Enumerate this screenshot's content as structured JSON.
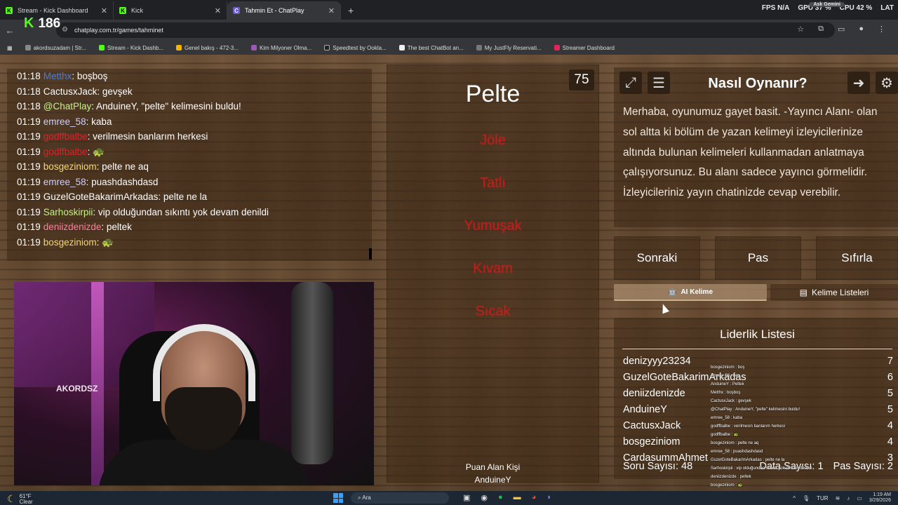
{
  "browser": {
    "tabs": [
      {
        "label": "Stream - Kick Dashboard",
        "icon": "kick-icon"
      },
      {
        "label": "Kick",
        "icon": "kick-icon"
      },
      {
        "label": "Tahmin Et - ChatPlay",
        "icon": "chatplay-icon",
        "active": true
      }
    ],
    "new_tab": "+",
    "url": "chatplay.com.tr/games/tahminet",
    "stats": {
      "fps": "FPS N/A",
      "gpu": "GPU 37 %",
      "cpu": "CPU 42 %",
      "lat": "LAT",
      "pill": "Ask Gemini"
    },
    "bookmarks": [
      "akordsuzadam | Str...",
      "Stream - Kick Dashb...",
      "Genel bakış - 472-3...",
      "Kim Milyoner Olma...",
      "Speedtest by Ookla...",
      "The best ChatBot an...",
      "My JustFly Reservati...",
      "Streamer Dashboard"
    ],
    "viewers": "186"
  },
  "chat": [
    {
      "time": "01:18",
      "user": "Metthx",
      "color": "#4a7bd8",
      "msg": ": boşboş"
    },
    {
      "time": "01:18",
      "user": "CactusxJack",
      "color": "#ffffff",
      "msg": ": gevşek"
    },
    {
      "time": "01:18",
      "user": "@ChatPlay",
      "color": "#c4f08a",
      "msg": ": AnduineY, \"pelte\" kelimesini buldu!"
    },
    {
      "time": "01:19",
      "user": "emree_58",
      "color": "#d0d0ff",
      "msg": ": kaba"
    },
    {
      "time": "01:19",
      "user": "godffbalbe",
      "color": "#e0202a",
      "msg": ": verilmesin banlarım herkesi"
    },
    {
      "time": "01:19",
      "user": "godffbalbe",
      "color": "#e0202a",
      "msg": ": 🐢"
    },
    {
      "time": "01:19",
      "user": "bosgeziniom",
      "color": "#f5d76e",
      "msg": ": pelte ne aq"
    },
    {
      "time": "01:19",
      "user": "emree_58",
      "color": "#d0d0ff",
      "msg": ": puashdashdasd"
    },
    {
      "time": "01:19",
      "user": "GuzelGoteBakarimArkadas",
      "color": "#ffffff",
      "msg": ": pelte ne la"
    },
    {
      "time": "01:19",
      "user": "Sarhoskirpii",
      "color": "#c4f08a",
      "msg": ": vip olduğundan sıkıntı yok devam denildi"
    },
    {
      "time": "01:19",
      "user": "deniizdenizde",
      "color": "#ff7b9c",
      "msg": ": peltek"
    },
    {
      "time": "01:19",
      "user": "bosgeziniom",
      "color": "#f5d76e",
      "msg": ": 🐢"
    }
  ],
  "webcam": {
    "logo": "AKORDSZ"
  },
  "game": {
    "timer": "75",
    "word": "Pelte",
    "taboo": [
      "Jöle",
      "Tatlı",
      "Yumuşak",
      "Kıvam",
      "Sıcak"
    ],
    "scorer_label": "Puan Alan Kişi",
    "scorer_name": "AnduineY"
  },
  "howto": {
    "title": "Nasıl Oynanır?",
    "text": "Merhaba, oyunumuz gayet basit. -Yayıncı Alanı- olan sol altta ki bölüm de yazan kelimeyi izleyicilerinize altında bulunan kelimeleri kullanmadan anlatmaya çalışıyorsunuz. Bu alanı sadece yayıncı görmelidir. İzleyicileriniz yayın chatinizde cevap verebilir."
  },
  "buttons": {
    "next": "Sonraki",
    "pass": "Pas",
    "reset": "Sıfırla"
  },
  "tabs": {
    "ai": "AI Kelime",
    "lists": "Kelime Listeleri"
  },
  "leaderboard": {
    "title": "Liderlik Listesi",
    "rows": [
      {
        "name": "denizyyy23234",
        "score": "7"
      },
      {
        "name": "GuzelGoteBakarimArkadas",
        "score": "6"
      },
      {
        "name": "deniizdenizde",
        "score": "5"
      },
      {
        "name": "AnduineY",
        "score": "5"
      },
      {
        "name": "CactusxJack",
        "score": "4"
      },
      {
        "name": "bosgeziniom",
        "score": "4"
      },
      {
        "name": "CardasummAhmet",
        "score": "3"
      }
    ],
    "questions": "Soru Sayısı: 48",
    "data_count": "Data Sayısı: 1",
    "pass_count": "Pas Sayısı: 2"
  },
  "overlay_chat": [
    "bosgeziniom : boş",
    "emree_58 : boş",
    "AnduineY : Peltek",
    "Metthx : boşboş",
    "CactusxJack : gevşek",
    "@ChatPlay : AnduineY, \"pelte\" kelimesini buldu!",
    "emree_58 : kaba",
    "godffbalbe : verilmesin banlarım herkesi",
    "godffbalbe : 🐢",
    "bosgeziniom : pelte ne aq",
    "emree_58 : puashdashdasd",
    "GuzelGoteBakarimArkadas : pelte ne la",
    "Sarhoskirpii : vip olduğundan sıkıntı yok devam denildi",
    "deniizdenizde : peltek",
    "bosgeziniom : 🐢"
  ],
  "taskbar": {
    "temp": "61°F",
    "weather": "Clear",
    "search": "Ara",
    "lang": "TUR",
    "time": "1:19 AM",
    "date": "3/29/2026"
  }
}
